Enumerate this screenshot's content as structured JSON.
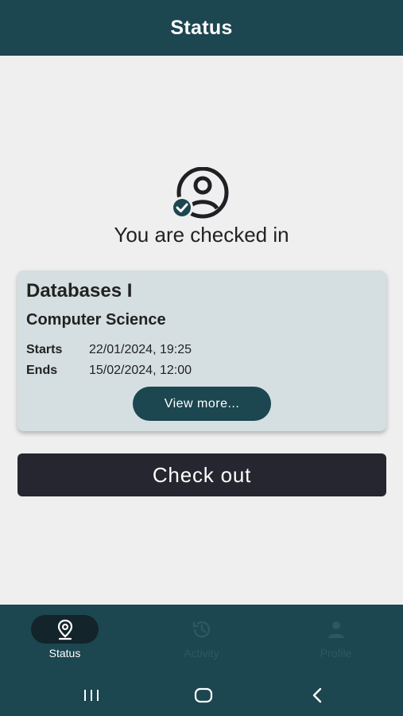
{
  "header": {
    "title": "Status"
  },
  "status": {
    "message": "You are checked in"
  },
  "session": {
    "course": "Databases I",
    "department": "Computer Science",
    "starts_label": "Starts",
    "starts_value": "22/01/2024, 19:25",
    "ends_label": "Ends",
    "ends_value": "15/02/2024, 12:00",
    "view_more_label": "View more..."
  },
  "actions": {
    "checkout_label": "Check out"
  },
  "bottom_nav": {
    "items": [
      {
        "label": "Status",
        "icon": "location-pin-icon",
        "active": true
      },
      {
        "label": "Activity",
        "icon": "history-icon",
        "active": false
      },
      {
        "label": "Profile",
        "icon": "person-icon",
        "active": false
      }
    ]
  },
  "system_nav": {
    "buttons": [
      "recent-apps-icon",
      "home-icon",
      "back-icon"
    ]
  },
  "colors": {
    "primary": "#1c4650",
    "background": "#efefef",
    "card": "#d5dfe1",
    "checkout_button": "#25262f",
    "active_pill": "#13242b"
  }
}
